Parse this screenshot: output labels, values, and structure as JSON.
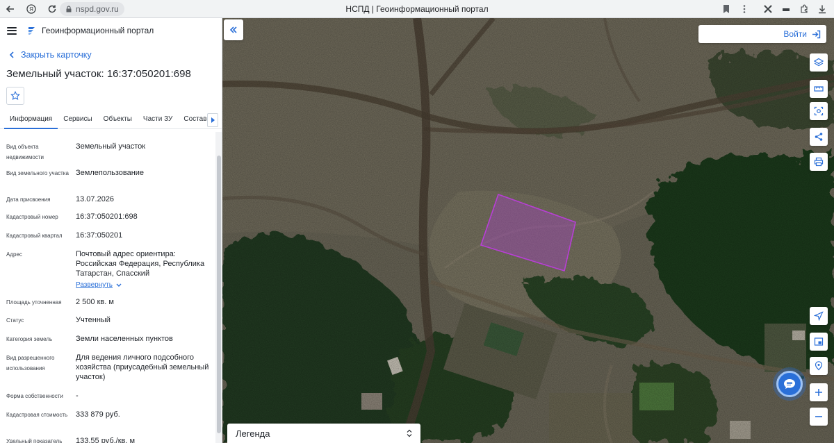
{
  "browser": {
    "url": "nspd.gov.ru",
    "tab_title": "НСПД | Геоинформационный портал"
  },
  "header": {
    "portal_name": "Геоинформационный портал"
  },
  "card": {
    "close_label": "Закрыть карточку",
    "title": "Земельный участок: 16:37:050201:698",
    "tabs": [
      "Информация",
      "Сервисы",
      "Объекты",
      "Части ЗУ",
      "Состав"
    ],
    "properties": [
      {
        "label": "Вид объекта недвижимости",
        "value": "Земельный участок"
      },
      {
        "label": "Вид земельного участка",
        "value": "Землепользование"
      },
      {
        "label": "Дата присвоения",
        "value": "13.07.2026"
      },
      {
        "label": "Кадастровый номер",
        "value": "16:37:050201:698"
      },
      {
        "label": "Кадастровый квартал",
        "value": "16:37:050201"
      },
      {
        "label": "Адрес",
        "value": "Почтовый адрес ориентира: Российская Федерация, Республика Татарстан, Спасский",
        "link": "Развернуть"
      },
      {
        "label": "Площадь уточненная",
        "value": "2 500 кв. м"
      },
      {
        "label": "Статус",
        "value": "Учтенный"
      },
      {
        "label": "Категория земель",
        "value": "Земли населенных пунктов"
      },
      {
        "label": "Вид разрешенного использования",
        "value": "Для ведения личного подсобного хозяйства (приусадебный земельный участок)"
      },
      {
        "label": "Форма собственности",
        "value": "-"
      },
      {
        "label": "Кадастровая стоимость",
        "value": "333 879 руб."
      },
      {
        "label": "Удельный показатель",
        "value": "133,55 руб./кв. м"
      }
    ]
  },
  "map": {
    "login_label": "Войти",
    "legend_label": "Легенда",
    "parcel_color": "#b83fd6",
    "accent": "#2a6fd8",
    "tools_top": [
      "layers-icon",
      "ruler-icon",
      "select-area-icon",
      "share-icon",
      "print-icon"
    ],
    "tools_bottom": [
      "locate-icon",
      "minimap-icon",
      "pin-icon",
      "zoom-in-icon",
      "zoom-out-icon"
    ]
  }
}
